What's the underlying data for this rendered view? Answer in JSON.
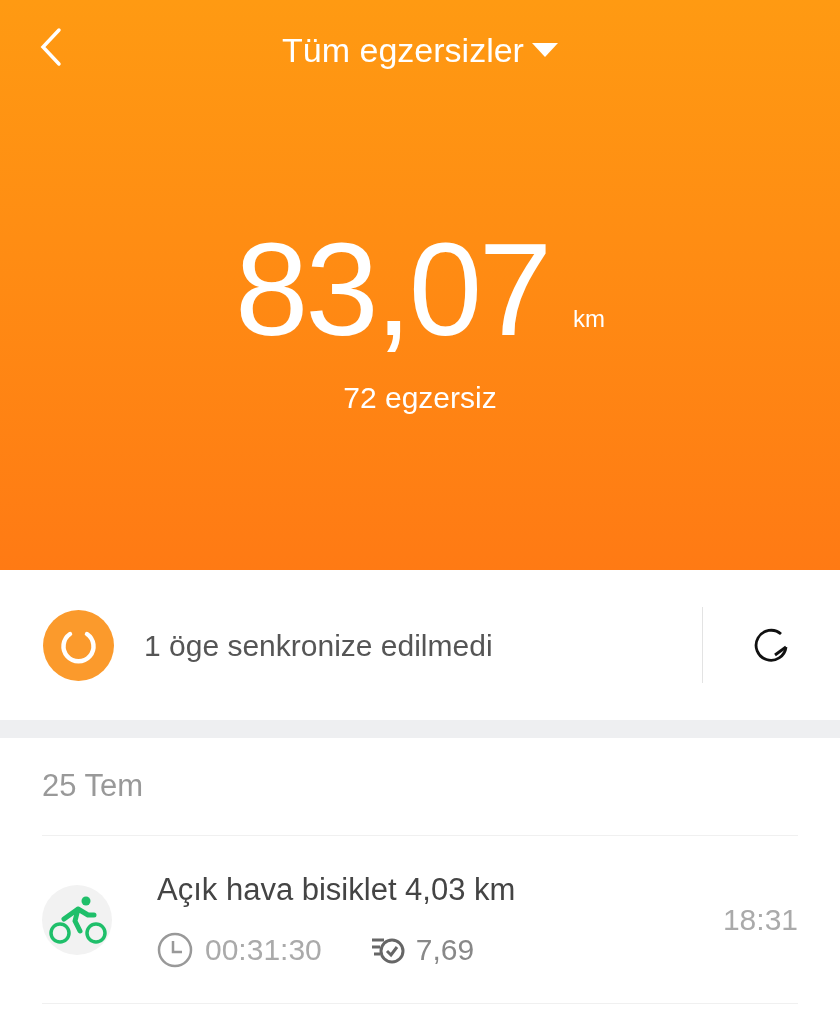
{
  "header": {
    "title": "Tüm egzersizler",
    "distance": "83,07",
    "unit": "km",
    "count": "72 egzersiz"
  },
  "sync": {
    "message": "1 öge senkronize edilmedi"
  },
  "groups": [
    {
      "date": "25 Tem",
      "activities": [
        {
          "title": "Açık hava bisiklet 4,03 km",
          "duration": "00:31:30",
          "pace": "7,69",
          "time": "18:31"
        }
      ]
    }
  ]
}
